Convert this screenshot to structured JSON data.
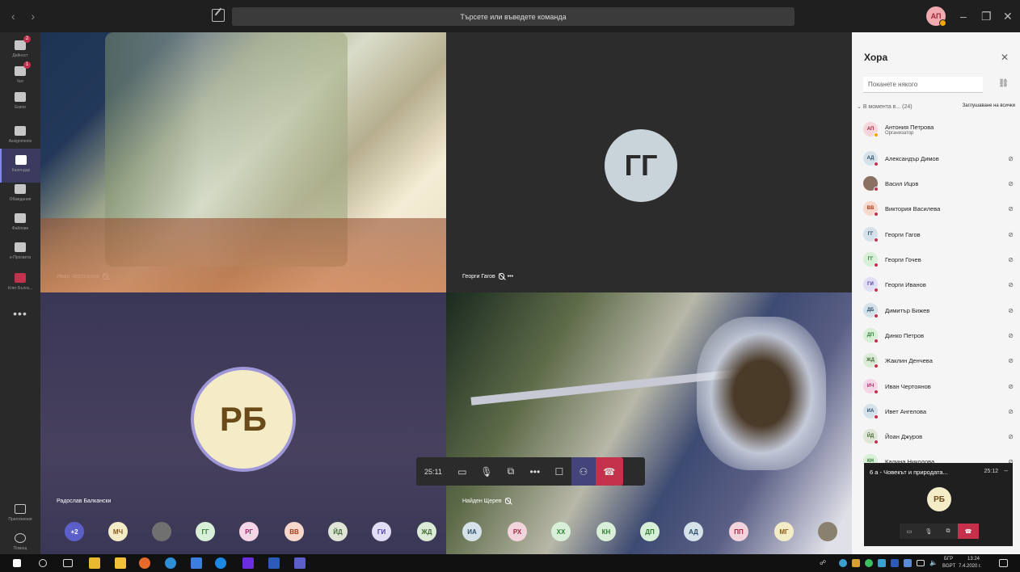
{
  "titlebar": {
    "search_placeholder": "Търсете или въведете команда",
    "user_initials": "АП"
  },
  "rail": {
    "items": [
      {
        "label": "Дейност",
        "icon": "bell-icon",
        "badge": "2"
      },
      {
        "label": "Чат",
        "icon": "chat-icon",
        "badge": "1"
      },
      {
        "label": "Екипи",
        "icon": "teams-icon"
      },
      {
        "label": "Assignments",
        "icon": "assignments-icon"
      },
      {
        "label": "Календар",
        "icon": "calendar-icon",
        "active": true
      },
      {
        "label": "Обаждания",
        "icon": "phone-icon"
      },
      {
        "label": "Файлове",
        "icon": "files-icon"
      },
      {
        "label": "e-Просвета",
        "icon": "book-icon"
      },
      {
        "label": "Клет Бълга...",
        "icon": "flag-icon"
      }
    ],
    "more": "•••",
    "apps_label": "Приложения",
    "help_label": "Помощ"
  },
  "stage": {
    "tiles": [
      {
        "name": "Иван Чертоянов",
        "muted": true
      },
      {
        "name": "Георги Гагов",
        "muted": true,
        "initials": "ГГ"
      },
      {
        "name": "Радослав Балкански",
        "initials": "РБ"
      },
      {
        "name": "Найден Щерев",
        "muted": true
      }
    ],
    "controls": {
      "timer": "25:11"
    },
    "gallery": [
      {
        "initials": "+2",
        "bg": "#5b5fc7",
        "fg": "#ffffff"
      },
      {
        "initials": "МЧ",
        "bg": "#f4ecc6",
        "fg": "#8a5a1a"
      },
      {
        "initials": "",
        "bg": "#707070",
        "fg": "#ffffff"
      },
      {
        "initials": "ГГ",
        "bg": "#d8efd8",
        "fg": "#2e7d32"
      },
      {
        "initials": "РГ",
        "bg": "#f6d6e6",
        "fg": "#a52a6a"
      },
      {
        "initials": "ВВ",
        "bg": "#f8d8cc",
        "fg": "#a33b1a"
      },
      {
        "initials": "ЙД",
        "bg": "#dfe6d8",
        "fg": "#4a6b3a"
      },
      {
        "initials": "ГИ",
        "bg": "#e2def6",
        "fg": "#4b3fa3"
      },
      {
        "initials": "ЖД",
        "bg": "#dcebd8",
        "fg": "#3e6b30"
      },
      {
        "initials": "ИА",
        "bg": "#d6e2ea",
        "fg": "#2a4f6b"
      },
      {
        "initials": "РХ",
        "bg": "#f4d4dc",
        "fg": "#a0283f"
      },
      {
        "initials": "ХХ",
        "bg": "#d8efd8",
        "fg": "#2e7d32"
      },
      {
        "initials": "КН",
        "bg": "#d8efd8",
        "fg": "#2e7d32"
      },
      {
        "initials": "ДП",
        "bg": "#d8efd8",
        "fg": "#2e7d32"
      },
      {
        "initials": "АД",
        "bg": "#d6e2ea",
        "fg": "#2a4f6b"
      },
      {
        "initials": "ПП",
        "bg": "#f4d4dc",
        "fg": "#a0283f"
      },
      {
        "initials": "МГ",
        "bg": "#f4ecc6",
        "fg": "#8a5a1a"
      },
      {
        "initials": "",
        "bg": "#8a8070",
        "fg": "#ffffff"
      }
    ]
  },
  "panel": {
    "title": "Хора",
    "invite_placeholder": "Поканете някого",
    "section": "В момента в... (24)",
    "mute_all": "Заглушаване на всички",
    "participants": [
      {
        "initials": "АП",
        "name": "Антония Петрова",
        "role": "Организатор",
        "bg": "#f6d6dc",
        "fg": "#a0283f",
        "organizer": true
      },
      {
        "initials": "АД",
        "name": "Александър Димов",
        "bg": "#d6e2ea",
        "fg": "#2a4f6b"
      },
      {
        "initials": "",
        "name": "Васил Ицов",
        "bg": "#8a7060",
        "fg": "#ffffff"
      },
      {
        "initials": "ВВ",
        "name": "Виктория Василева",
        "bg": "#f8d8cc",
        "fg": "#a33b1a"
      },
      {
        "initials": "ГГ",
        "name": "Георги Гагов",
        "bg": "#d6e2ea",
        "fg": "#2a4f6b"
      },
      {
        "initials": "ГГ",
        "name": "Георги Гочев",
        "bg": "#d8efd8",
        "fg": "#2e7d32"
      },
      {
        "initials": "ГИ",
        "name": "Георги Иванов",
        "bg": "#e2def6",
        "fg": "#4b3fa3"
      },
      {
        "initials": "ДБ",
        "name": "Димитър Бижев",
        "bg": "#d6e2ea",
        "fg": "#2a4f6b"
      },
      {
        "initials": "ДП",
        "name": "Динко Петров",
        "bg": "#d8efd8",
        "fg": "#2e7d32"
      },
      {
        "initials": "ЖД",
        "name": "Жаклин Денчева",
        "bg": "#dcebd8",
        "fg": "#3e6b30"
      },
      {
        "initials": "ИЧ",
        "name": "Иван Чертоянов",
        "bg": "#f6d6e6",
        "fg": "#a52a6a"
      },
      {
        "initials": "ИА",
        "name": "Ивет Ангелова",
        "bg": "#d6e2ea",
        "fg": "#2a4f6b"
      },
      {
        "initials": "ЙД",
        "name": "Йоан Джуров",
        "bg": "#dfe6d8",
        "fg": "#4a6b3a"
      },
      {
        "initials": "КН",
        "name": "Калина Николова",
        "bg": "#d8efd8",
        "fg": "#2e7d32"
      }
    ]
  },
  "mini": {
    "title": "6 а - Човекът и природата...",
    "time": "25:12",
    "initials": "РБ"
  },
  "taskbar": {
    "lang": "БГР",
    "layout": "BGPT",
    "time": "13:24",
    "date": "7.4.2020 г."
  }
}
